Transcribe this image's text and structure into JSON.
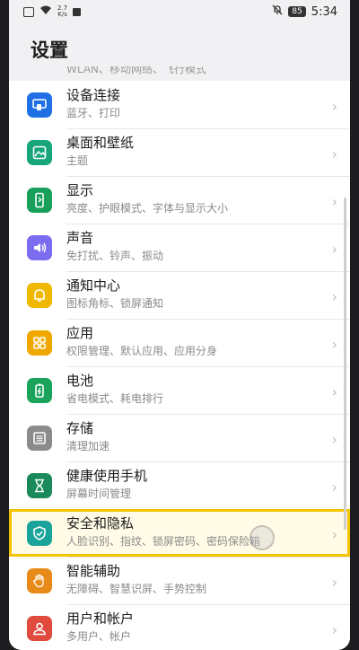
{
  "status_bar": {
    "net_speed": "2.7\nK/s",
    "battery": "85",
    "time": "5:34"
  },
  "page": {
    "title": "设置"
  },
  "clipped_item_text": "WLAN、移动网络、飞行模式",
  "items": [
    {
      "title": "设备连接",
      "sub": "蓝牙、打印",
      "icon": "device-connection-icon",
      "color": "#1f6fe5"
    },
    {
      "title": "桌面和壁纸",
      "sub": "主题",
      "icon": "wallpaper-icon",
      "color": "#16a67a"
    },
    {
      "title": "显示",
      "sub": "亮度、护眼模式、字体与显示大小",
      "icon": "display-icon",
      "color": "#18a05b"
    },
    {
      "title": "声音",
      "sub": "免打扰、铃声、振动",
      "icon": "sound-icon",
      "color": "#7b6cf0"
    },
    {
      "title": "通知中心",
      "sub": "图标角标、锁屏通知",
      "icon": "notification-icon",
      "color": "#f0b800"
    },
    {
      "title": "应用",
      "sub": "权限管理、默认应用、应用分身",
      "icon": "apps-icon",
      "color": "#f0a800"
    },
    {
      "title": "电池",
      "sub": "省电模式、耗电排行",
      "icon": "battery-icon",
      "color": "#1aa35a"
    },
    {
      "title": "存储",
      "sub": "清理加速",
      "icon": "storage-icon",
      "color": "#8b8b8b"
    },
    {
      "title": "健康使用手机",
      "sub": "屏幕时间管理",
      "icon": "hourglass-icon",
      "color": "#1a8a5a"
    },
    {
      "title": "安全和隐私",
      "sub": "人脸识别、指纹、锁屏密码、密码保险箱",
      "icon": "shield-icon",
      "color": "#1aa39a"
    },
    {
      "title": "智能辅助",
      "sub": "无障碍、智慧识屏、手势控制",
      "icon": "assist-hand-icon",
      "color": "#e88a1a"
    },
    {
      "title": "用户和帐户",
      "sub": "多用户、帐户",
      "icon": "user-icon",
      "color": "#e04b3d"
    }
  ]
}
